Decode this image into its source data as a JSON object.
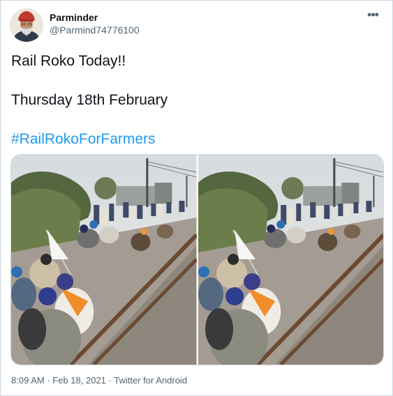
{
  "author": {
    "display_name": "Parminder",
    "handle": "@Parmind74776100",
    "avatar_icon": "profile-avatar-turban"
  },
  "menu": {
    "more_label": "•••",
    "icon": "more-horizontal-icon"
  },
  "tweet": {
    "line1": "Rail Roko Today!!",
    "line2": "Thursday 18th February",
    "hashtag": "#RailRokoForFarmers"
  },
  "media": {
    "photo_count": 2
  },
  "meta": {
    "time": "8:09 AM",
    "separator": "·",
    "date": "Feb 18, 2021",
    "source": "Twitter for Android"
  },
  "colors": {
    "link": "#1d9bf0",
    "secondary_text": "#536471",
    "border": "#cfd9de",
    "turban_red": "#c0392b"
  }
}
